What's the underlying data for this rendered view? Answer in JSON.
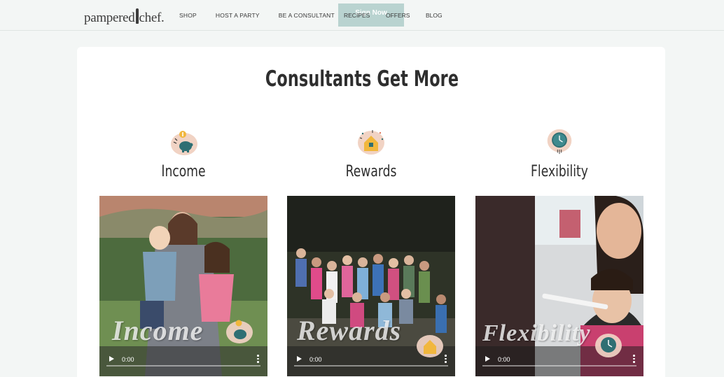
{
  "brand": {
    "logo_left": "pampered",
    "logo_right": "chef."
  },
  "nav": {
    "items": [
      "SHOP",
      "HOST A PARTY",
      "BE A CONSULTANT",
      "RECIPES",
      "OFFERS",
      "BLOG"
    ],
    "signup_label": "Sign Now"
  },
  "main": {
    "heading": "Consultants Get More",
    "features": [
      {
        "title": "Income",
        "icon": "piggy-bank-coin-icon",
        "video_overlay": "Income",
        "time": "0:00"
      },
      {
        "title": "Rewards",
        "icon": "gift-house-icon",
        "video_overlay": "Rewards",
        "time": "0:00"
      },
      {
        "title": "Flexibility",
        "icon": "clock-icon",
        "video_overlay": "Flexibility",
        "time": "0:00"
      }
    ]
  },
  "colors": {
    "page_bg": "#f3f6f5",
    "signup_bg": "#b9d3d0",
    "icon_blob": "#f1d3c4",
    "icon_teal": "#2f6f73",
    "icon_yellow": "#f1b73d"
  }
}
